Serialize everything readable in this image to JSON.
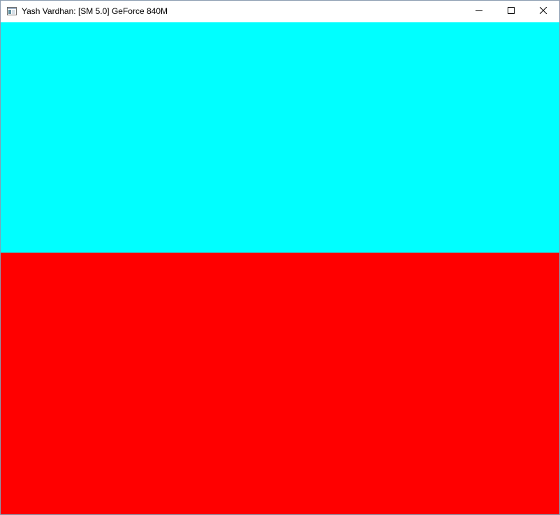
{
  "window": {
    "title": "Yash Vardhan: [SM 5.0] GeForce 840M",
    "icon": "application-window-icon",
    "controls": {
      "minimize_icon": "minimize-icon",
      "maximize_icon": "maximize-icon",
      "close_icon": "close-icon"
    }
  },
  "colors": {
    "top_band": "#00FFFF",
    "bottom_band": "#FF0000"
  }
}
